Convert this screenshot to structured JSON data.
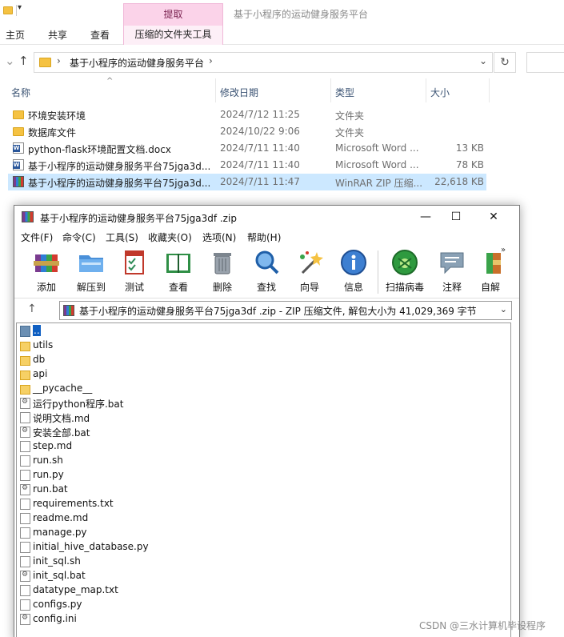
{
  "explorer": {
    "context_tab": "提取",
    "window_title": "基于小程序的运动健身服务平台",
    "ribbon_tabs": [
      "主页",
      "共享",
      "查看"
    ],
    "context_subtab": "压缩的文件夹工具",
    "address": "基于小程序的运动健身服务平台",
    "columns": {
      "name": "名称",
      "date": "修改日期",
      "type": "类型",
      "size": "大小"
    },
    "files": [
      {
        "name": "环境安装环境",
        "date": "2024/7/12 11:25",
        "type": "文件夹",
        "size": "",
        "icon": "folder-icon"
      },
      {
        "name": "数据库文件",
        "date": "2024/10/22 9:06",
        "type": "文件夹",
        "size": "",
        "icon": "folder-icon"
      },
      {
        "name": "python-flask环境配置文档.docx",
        "date": "2024/7/11 11:40",
        "type": "Microsoft Word ...",
        "size": "13 KB",
        "icon": "word-doc-icon"
      },
      {
        "name": "基于小程序的运动健身服务平台75jga3d...",
        "date": "2024/7/11 11:40",
        "type": "Microsoft Word ...",
        "size": "78 KB",
        "icon": "word-doc-icon"
      },
      {
        "name": "基于小程序的运动健身服务平台75jga3d...",
        "date": "2024/7/11 11:47",
        "type": "WinRAR ZIP 压缩...",
        "size": "22,618 KB",
        "icon": "winrar-archive-icon",
        "selected": true
      }
    ]
  },
  "winrar": {
    "title": "基于小程序的运动健身服务平台75jga3df .zip",
    "window_buttons": {
      "minimize": "—",
      "maximize": "☐",
      "close": "✕"
    },
    "menu": [
      "文件(F)",
      "命令(C)",
      "工具(S)",
      "收藏夹(O)",
      "选项(N)",
      "帮助(H)"
    ],
    "toolbar": [
      {
        "label": "添加",
        "icon": "add-archive-icon"
      },
      {
        "label": "解压到",
        "icon": "extract-to-folder-icon"
      },
      {
        "label": "测试",
        "icon": "test-checklist-icon"
      },
      {
        "label": "查看",
        "icon": "view-book-icon"
      },
      {
        "label": "删除",
        "icon": "delete-trash-icon"
      },
      {
        "label": "查找",
        "icon": "find-magnifier-icon"
      },
      {
        "label": "向导",
        "icon": "wizard-wand-icon"
      },
      {
        "label": "信息",
        "icon": "info-icon"
      },
      {
        "label": "扫描病毒",
        "icon": "virus-scan-icon"
      },
      {
        "label": "注释",
        "icon": "comment-bubble-icon"
      },
      {
        "label": "自解",
        "icon": "sfx-icon"
      }
    ],
    "path_text": "基于小程序的运动健身服务平台75jga3df .zip - ZIP 压缩文件, 解包大小为 41,029,369 字节",
    "items": [
      {
        "name": "..",
        "kind": "up"
      },
      {
        "name": "utils",
        "kind": "folder"
      },
      {
        "name": "db",
        "kind": "folder"
      },
      {
        "name": "api",
        "kind": "folder"
      },
      {
        "name": "__pycache__",
        "kind": "folder"
      },
      {
        "name": "运行python程序.bat",
        "kind": "bat"
      },
      {
        "name": "说明文档.md",
        "kind": "file"
      },
      {
        "name": "安装全部.bat",
        "kind": "bat"
      },
      {
        "name": "step.md",
        "kind": "file"
      },
      {
        "name": "run.sh",
        "kind": "file"
      },
      {
        "name": "run.py",
        "kind": "file"
      },
      {
        "name": "run.bat",
        "kind": "bat"
      },
      {
        "name": "requirements.txt",
        "kind": "file"
      },
      {
        "name": "readme.md",
        "kind": "file"
      },
      {
        "name": "manage.py",
        "kind": "file"
      },
      {
        "name": "initial_hive_database.py",
        "kind": "file"
      },
      {
        "name": "init_sql.sh",
        "kind": "file"
      },
      {
        "name": "init_sql.bat",
        "kind": "bat"
      },
      {
        "name": "datatype_map.txt",
        "kind": "file"
      },
      {
        "name": "configs.py",
        "kind": "file"
      },
      {
        "name": "config.ini",
        "kind": "bat"
      }
    ]
  },
  "watermark": "CSDN @三水计算机毕设程序"
}
